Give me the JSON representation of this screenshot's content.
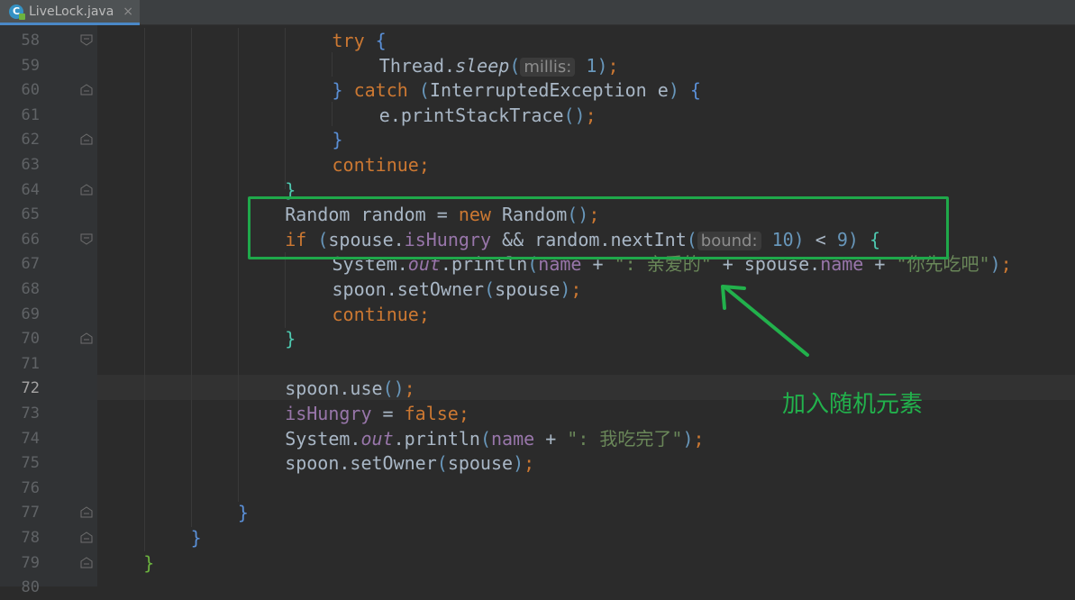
{
  "tab": {
    "icon": "java-class-icon",
    "icon_letter": "C",
    "title": "LiveLock.java",
    "close": "×"
  },
  "lines": [
    {
      "n": "58",
      "fold": "open",
      "indent": 5,
      "tokens": [
        [
          "kw",
          "try"
        ],
        [
          "op",
          " "
        ],
        [
          "brace-blue",
          "{"
        ]
      ]
    },
    {
      "n": "59",
      "fold": "",
      "indent": 6,
      "tokens": [
        [
          "op",
          "Thread."
        ],
        [
          "fn-static",
          "sleep"
        ],
        [
          "paren-blue",
          "("
        ],
        [
          "hint",
          "millis:"
        ],
        [
          "num",
          " 1"
        ],
        [
          "paren-blue",
          ")"
        ],
        [
          "kw",
          ";"
        ]
      ]
    },
    {
      "n": "60",
      "fold": "close",
      "indent": 5,
      "tokens": [
        [
          "brace-blue",
          "}"
        ],
        [
          "op",
          " "
        ],
        [
          "kw",
          "catch"
        ],
        [
          "op",
          " "
        ],
        [
          "paren-blue",
          "("
        ],
        [
          "op",
          "InterruptedException e"
        ],
        [
          "paren-blue",
          ")"
        ],
        [
          "op",
          " "
        ],
        [
          "brace-blue",
          "{"
        ]
      ]
    },
    {
      "n": "61",
      "fold": "",
      "indent": 6,
      "tokens": [
        [
          "op",
          "e.printStackTrace"
        ],
        [
          "paren-blue",
          "()"
        ],
        [
          "kw",
          ";"
        ]
      ]
    },
    {
      "n": "62",
      "fold": "close",
      "indent": 5,
      "tokens": [
        [
          "brace-blue",
          "}"
        ]
      ]
    },
    {
      "n": "63",
      "fold": "",
      "indent": 5,
      "tokens": [
        [
          "kw",
          "continue;"
        ]
      ]
    },
    {
      "n": "64",
      "fold": "close",
      "indent": 4,
      "tokens": [
        [
          "brace-teal",
          "}"
        ]
      ]
    },
    {
      "n": "65",
      "fold": "",
      "indent": 4,
      "tokens": [
        [
          "op",
          "Random random = "
        ],
        [
          "kw",
          "new"
        ],
        [
          "op",
          " Random"
        ],
        [
          "paren-blue",
          "()"
        ],
        [
          "kw",
          ";"
        ]
      ]
    },
    {
      "n": "66",
      "fold": "open",
      "indent": 4,
      "tokens": [
        [
          "kw",
          "if"
        ],
        [
          "op",
          " "
        ],
        [
          "paren-blue",
          "("
        ],
        [
          "op",
          "spouse."
        ],
        [
          "field",
          "isHungry"
        ],
        [
          "op",
          " && random.nextInt"
        ],
        [
          "paren-blue",
          "("
        ],
        [
          "hint",
          "bound:"
        ],
        [
          "num",
          " 10"
        ],
        [
          "paren-blue",
          ")"
        ],
        [
          "op",
          " < "
        ],
        [
          "num",
          "9"
        ],
        [
          "paren-blue",
          ")"
        ],
        [
          "op",
          " "
        ],
        [
          "brace-teal",
          "{"
        ]
      ]
    },
    {
      "n": "67",
      "fold": "",
      "indent": 5,
      "tokens": [
        [
          "op",
          "System."
        ],
        [
          "field-i",
          "out"
        ],
        [
          "op",
          ".println"
        ],
        [
          "paren-blue",
          "("
        ],
        [
          "field",
          "name"
        ],
        [
          "op",
          " + "
        ],
        [
          "str",
          "\": 亲爱的\""
        ],
        [
          "op",
          " + spouse."
        ],
        [
          "field",
          "name"
        ],
        [
          "op",
          " + "
        ],
        [
          "str",
          "\"你先吃吧\""
        ],
        [
          "paren-blue",
          ")"
        ],
        [
          "kw",
          ";"
        ]
      ]
    },
    {
      "n": "68",
      "fold": "",
      "indent": 5,
      "tokens": [
        [
          "op",
          "spoon.setOwner"
        ],
        [
          "paren-blue",
          "("
        ],
        [
          "op",
          "spouse"
        ],
        [
          "paren-blue",
          ")"
        ],
        [
          "kw",
          ";"
        ]
      ]
    },
    {
      "n": "69",
      "fold": "",
      "indent": 5,
      "tokens": [
        [
          "kw",
          "continue;"
        ]
      ]
    },
    {
      "n": "70",
      "fold": "close",
      "indent": 4,
      "tokens": [
        [
          "brace-teal",
          "}"
        ]
      ]
    },
    {
      "n": "71",
      "fold": "",
      "indent": 0,
      "tokens": []
    },
    {
      "n": "72",
      "fold": "",
      "indent": 4,
      "active": true,
      "tokens": [
        [
          "op",
          "spoon.use"
        ],
        [
          "paren-blue",
          "()"
        ],
        [
          "kw",
          ";"
        ]
      ]
    },
    {
      "n": "73",
      "fold": "",
      "indent": 4,
      "tokens": [
        [
          "field",
          "isHungry"
        ],
        [
          "op",
          " = "
        ],
        [
          "kw",
          "false;"
        ]
      ]
    },
    {
      "n": "74",
      "fold": "",
      "indent": 4,
      "tokens": [
        [
          "op",
          "System."
        ],
        [
          "field-i",
          "out"
        ],
        [
          "op",
          ".println"
        ],
        [
          "paren-blue",
          "("
        ],
        [
          "field",
          "name"
        ],
        [
          "op",
          " + "
        ],
        [
          "str",
          "\": 我吃完了\""
        ],
        [
          "paren-blue",
          ")"
        ],
        [
          "kw",
          ";"
        ]
      ]
    },
    {
      "n": "75",
      "fold": "",
      "indent": 4,
      "tokens": [
        [
          "op",
          "spoon.setOwner"
        ],
        [
          "paren-blue",
          "("
        ],
        [
          "op",
          "spouse"
        ],
        [
          "paren-blue",
          ")"
        ],
        [
          "kw",
          ";"
        ]
      ]
    },
    {
      "n": "76",
      "fold": "",
      "indent": 0,
      "tokens": []
    },
    {
      "n": "77",
      "fold": "close",
      "indent": 3,
      "tokens": [
        [
          "brace-blue",
          "}"
        ]
      ]
    },
    {
      "n": "78",
      "fold": "close",
      "indent": 2,
      "tokens": [
        [
          "brace-blue",
          "}"
        ]
      ]
    },
    {
      "n": "79",
      "fold": "close",
      "indent": 1,
      "tokens": [
        [
          "brace-green",
          "}"
        ]
      ]
    },
    {
      "n": "80",
      "fold": "",
      "indent": 0,
      "tokens": []
    }
  ],
  "annotation": {
    "text": "加入随机元素",
    "color": "#22b14c"
  },
  "colors": {
    "keyword": "#cc7832",
    "field": "#9876aa",
    "number": "#6897bb",
    "string": "#6a8759",
    "highlight_box": "#1fa84a"
  }
}
